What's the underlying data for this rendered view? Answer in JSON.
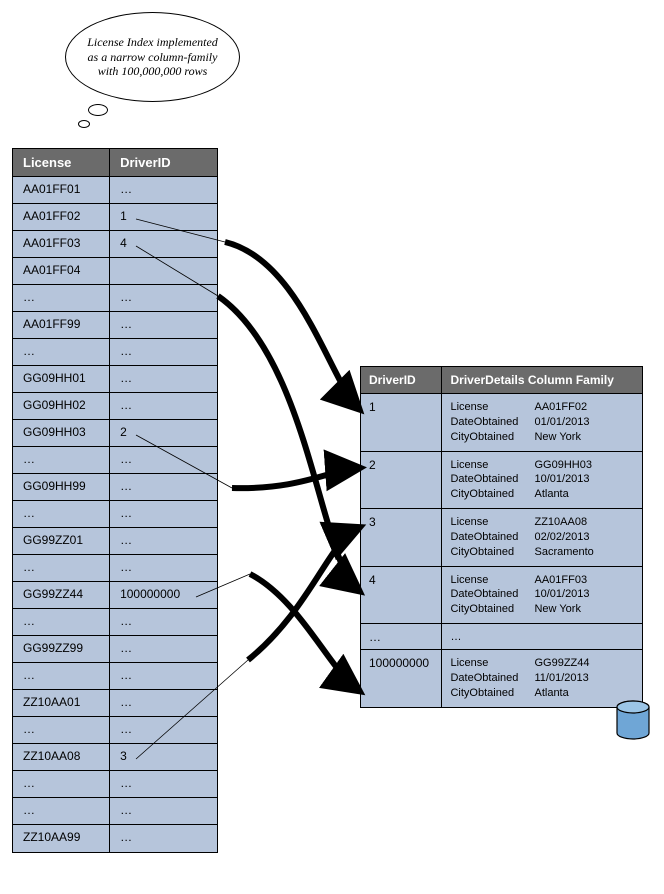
{
  "bubble_text": "License Index implemented as a narrow column-family with 100,000,000 rows",
  "index_table": {
    "headers": {
      "col1": "License",
      "col2": "DriverID"
    },
    "rows": [
      {
        "license": "AA01FF01",
        "driver": "…"
      },
      {
        "license": "AA01FF02",
        "driver": "1"
      },
      {
        "license": "AA01FF03",
        "driver": "4"
      },
      {
        "license": "AA01FF04",
        "driver": ""
      },
      {
        "license": "…",
        "driver": "…"
      },
      {
        "license": "AA01FF99",
        "driver": "…"
      },
      {
        "license": "…",
        "driver": "…"
      },
      {
        "license": "GG09HH01",
        "driver": "…"
      },
      {
        "license": "GG09HH02",
        "driver": "…"
      },
      {
        "license": "GG09HH03",
        "driver": "2"
      },
      {
        "license": "…",
        "driver": "…"
      },
      {
        "license": "GG09HH99",
        "driver": "…"
      },
      {
        "license": "…",
        "driver": "…"
      },
      {
        "license": "GG99ZZ01",
        "driver": "…"
      },
      {
        "license": "…",
        "driver": "…"
      },
      {
        "license": "GG99ZZ44",
        "driver": "100000000"
      },
      {
        "license": "…",
        "driver": "…"
      },
      {
        "license": "GG99ZZ99",
        "driver": "…"
      },
      {
        "license": "…",
        "driver": "…"
      },
      {
        "license": "ZZ10AA01",
        "driver": "…"
      },
      {
        "license": "…",
        "driver": "…"
      },
      {
        "license": "ZZ10AA08",
        "driver": "3"
      },
      {
        "license": "…",
        "driver": "…"
      },
      {
        "license": "…",
        "driver": "…"
      },
      {
        "license": "ZZ10AA99",
        "driver": "…"
      }
    ]
  },
  "details_table": {
    "headers": {
      "col1": "DriverID",
      "col2": "DriverDetails Column Family"
    },
    "keys": {
      "k1": "License",
      "k2": "DateObtained",
      "k3": "CityObtained"
    },
    "rows": [
      {
        "id": "1",
        "license": "AA01FF02",
        "date": "01/01/2013",
        "city": "New York"
      },
      {
        "id": "2",
        "license": "GG09HH03",
        "date": "10/01/2013",
        "city": "Atlanta"
      },
      {
        "id": "3",
        "license": "ZZ10AA08",
        "date": "02/02/2013",
        "city": "Sacramento"
      },
      {
        "id": "4",
        "license": "AA01FF03",
        "date": "10/01/2013",
        "city": "New York"
      }
    ],
    "ellipsis": {
      "id": "…",
      "details": "…"
    },
    "last_row": {
      "id": "100000000",
      "license": "GG99ZZ44",
      "date": "11/01/2013",
      "city": "Atlanta"
    }
  }
}
